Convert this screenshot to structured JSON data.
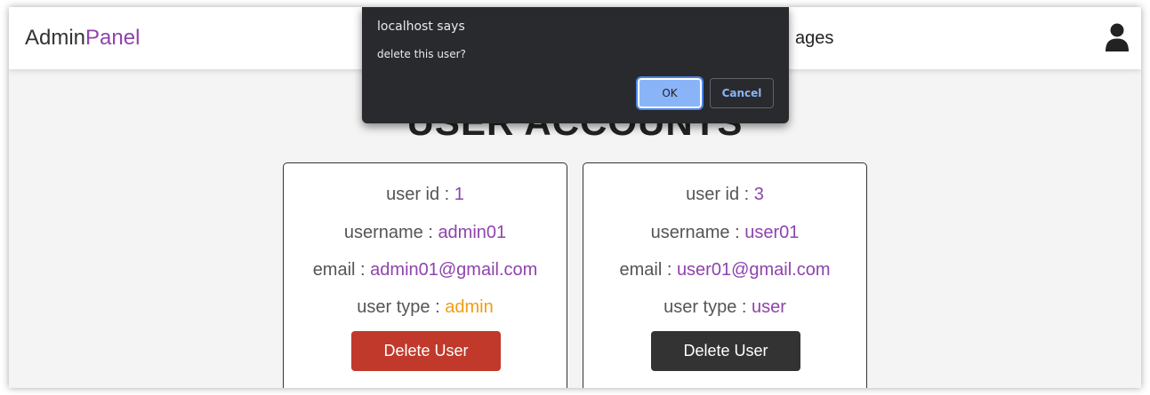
{
  "navbar": {
    "logo_main": "Admin",
    "logo_accent": "Panel",
    "nav_text": "ages",
    "user_icon": "user-icon"
  },
  "page": {
    "heading": "USER ACCOUNTS"
  },
  "colors": {
    "accent": "#8e44ad",
    "admin_type": "#f39c12",
    "delete_red": "#c0392b",
    "delete_dark": "#333333"
  },
  "users": [
    {
      "id_label": "user id : ",
      "id": "1",
      "username_label": "username : ",
      "username": "admin01",
      "email_label": "email : ",
      "email": "admin01@gmail.com",
      "type_label": "user type : ",
      "type": "admin",
      "button": "Delete User"
    },
    {
      "id_label": "user id : ",
      "id": "3",
      "username_label": "username : ",
      "username": "user01",
      "email_label": "email : ",
      "email": "user01@gmail.com",
      "type_label": "user type : ",
      "type": "user",
      "button": "Delete User"
    }
  ],
  "dialog": {
    "title": "localhost says",
    "message": "delete this user?",
    "ok": "OK",
    "cancel": "Cancel"
  }
}
